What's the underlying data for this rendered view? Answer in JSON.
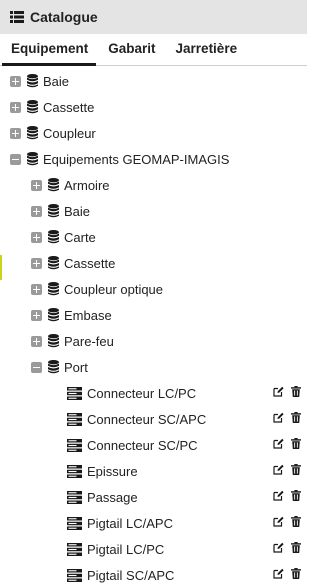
{
  "header": {
    "title": "Catalogue",
    "icon": "list-icon"
  },
  "tabs": [
    {
      "label": "Equipement",
      "active": true
    },
    {
      "label": "Gabarit",
      "active": false
    },
    {
      "label": "Jarretière",
      "active": false
    }
  ],
  "tree": {
    "root_items": [
      {
        "label": "Baie",
        "expanded": false
      },
      {
        "label": "Cassette",
        "expanded": false
      },
      {
        "label": "Coupleur",
        "expanded": false
      },
      {
        "label": "Equipements GEOMAP-IMAGIS",
        "expanded": true
      }
    ],
    "geomap_children": [
      {
        "label": "Armoire",
        "expanded": false
      },
      {
        "label": "Baie",
        "expanded": false
      },
      {
        "label": "Carte",
        "expanded": false
      },
      {
        "label": "Cassette",
        "expanded": false
      },
      {
        "label": "Coupleur optique",
        "expanded": false
      },
      {
        "label": "Embase",
        "expanded": false
      },
      {
        "label": "Pare-feu",
        "expanded": false
      },
      {
        "label": "Port",
        "expanded": true
      }
    ],
    "port_children": [
      {
        "label": "Connecteur LC/PC"
      },
      {
        "label": "Connecteur SC/APC"
      },
      {
        "label": "Connecteur SC/PC"
      },
      {
        "label": "Epissure"
      },
      {
        "label": "Passage"
      },
      {
        "label": "Pigtail LC/APC"
      },
      {
        "label": "Pigtail LC/PC"
      },
      {
        "label": "Pigtail SC/APC"
      }
    ]
  },
  "colors": {
    "header_bg": "#e4e4e4",
    "toggle": "#9a9a9a",
    "icon": "#1a1a1a",
    "left_marker": "#c9d51a"
  }
}
